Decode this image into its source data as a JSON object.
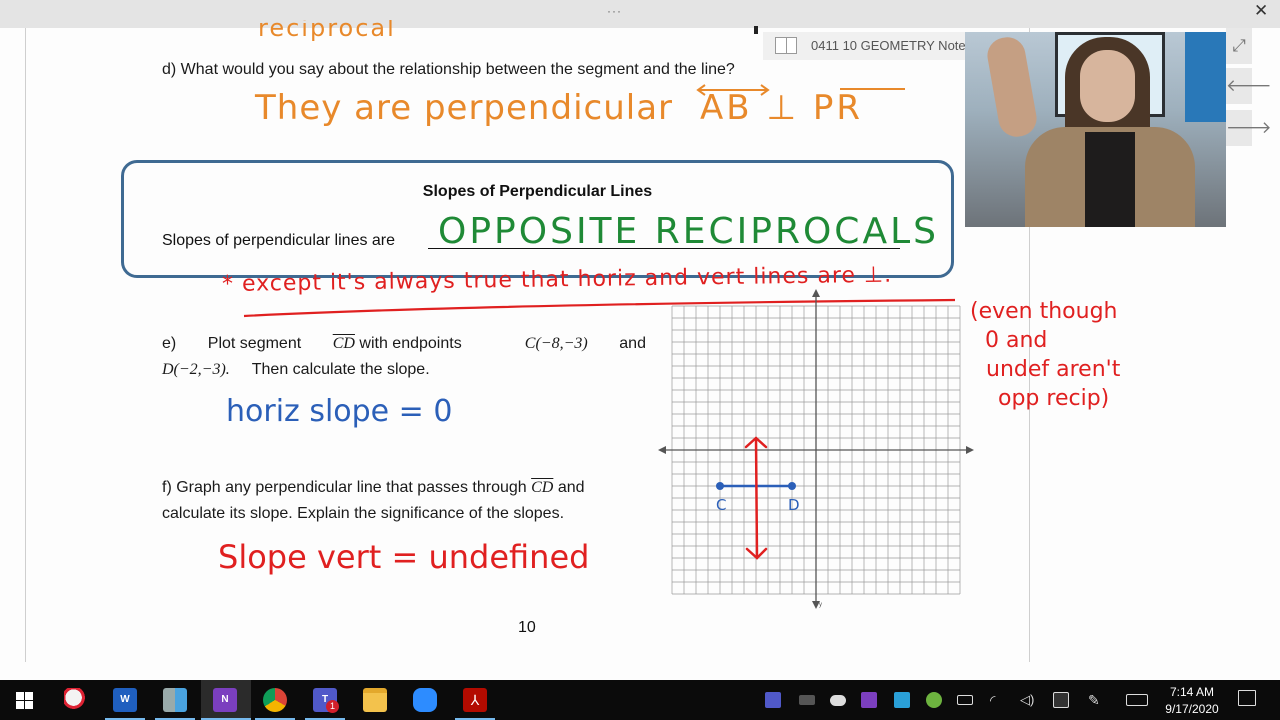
{
  "window": {
    "more_label": "···",
    "close_label": "✕"
  },
  "onenote_chip": {
    "notebook_icon": "notebook-icon",
    "title": "0411 10 GEOMETRY Note"
  },
  "webcam_controls": [
    {
      "name": "expand",
      "glyph": "⤢"
    },
    {
      "name": "back",
      "glyph": "🡐"
    },
    {
      "name": "forward",
      "glyph": "🡒"
    }
  ],
  "document": {
    "prev_answer_fragment": "reciprocal",
    "question_d": "d)  What would you say about the relationship between the segment and the line?",
    "answer_d": "They are perpendicular",
    "answer_d_math": "AB ⊥ PR",
    "box": {
      "title": "Slopes of Perpendicular Lines",
      "prompt": "Slopes of perpendicular lines are",
      "answer": "OPPOSITE RECIPROCALS"
    },
    "note_except": "* except it's always true that horiz and vert lines are ⊥.",
    "note_even_though": [
      "(even though",
      "0 and",
      "undef aren't",
      "opp recip)"
    ],
    "question_e": {
      "label": "e)",
      "text_1": "Plot segment",
      "segment": "CD",
      "text_2": "with endpoints",
      "point_c": "C(−8,−3)",
      "and": "and",
      "point_d": "D(−2,−3).",
      "text_3": "Then calculate the slope."
    },
    "answer_e": "horiz slope = 0",
    "question_f": {
      "text_1": "f)  Graph any perpendicular line that passes through",
      "segment": "CD",
      "text_2": "and",
      "line2": "calculate its slope.  Explain the significance of the slopes."
    },
    "answer_f": "Slope vert  =  undefined",
    "page_number": "10"
  },
  "chart_data": {
    "type": "scatter",
    "title": "",
    "xlabel": "",
    "ylabel": "y",
    "xlim": [
      -12,
      12
    ],
    "ylim": [
      -12,
      12
    ],
    "grid": true,
    "points": [
      {
        "label": "C",
        "x": -8,
        "y": -3
      },
      {
        "label": "D",
        "x": -2,
        "y": -3
      }
    ],
    "segments": [
      {
        "name": "CD",
        "from": [
          -8,
          -3
        ],
        "to": [
          -2,
          -3
        ],
        "color": "#2b5fb8"
      }
    ],
    "lines": [
      {
        "name": "perpendicular-line",
        "x": -5,
        "from_y": 1,
        "to_y": -9,
        "color": "#e02020",
        "arrows": "both"
      }
    ]
  },
  "taskbar": {
    "apps": [
      {
        "name": "start",
        "icon": "windows-icon"
      },
      {
        "name": "snipping-tool",
        "icon": "snip-icon"
      },
      {
        "name": "word",
        "icon": "word-icon"
      },
      {
        "name": "calculator",
        "icon": "calculator-icon"
      },
      {
        "name": "onenote",
        "icon": "onenote-icon",
        "active": true
      },
      {
        "name": "chrome",
        "icon": "chrome-icon"
      },
      {
        "name": "teams",
        "icon": "teams-icon",
        "badge": "1"
      },
      {
        "name": "file-explorer",
        "icon": "folder-icon"
      },
      {
        "name": "zoom",
        "icon": "zoom-icon"
      },
      {
        "name": "acrobat",
        "icon": "acrobat-icon"
      }
    ],
    "tray": [
      "teams-tray-icon",
      "camera-tray-icon",
      "cloud-tray-icon",
      "onenote-tray-icon",
      "sync-tray-icon",
      "vpn-tray-icon",
      "battery-icon",
      "wifi-icon",
      "volume-icon",
      "security-icon",
      "pen-icon",
      "keyboard-icon"
    ],
    "time": "7:14 AM",
    "date": "9/17/2020"
  },
  "colors": {
    "ink_orange": "#e8892b",
    "ink_green": "#1f8a36",
    "ink_red": "#e02020",
    "ink_blue": "#2b5fb8",
    "box_border": "#3f6a92"
  }
}
